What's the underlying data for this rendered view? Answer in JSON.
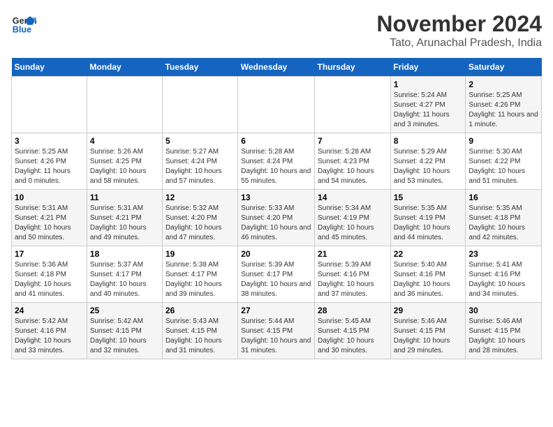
{
  "logo": {
    "line1": "General",
    "line2": "Blue"
  },
  "title": "November 2024",
  "subtitle": "Tato, Arunachal Pradesh, India",
  "days_of_week": [
    "Sunday",
    "Monday",
    "Tuesday",
    "Wednesday",
    "Thursday",
    "Friday",
    "Saturday"
  ],
  "weeks": [
    [
      {
        "num": "",
        "info": ""
      },
      {
        "num": "",
        "info": ""
      },
      {
        "num": "",
        "info": ""
      },
      {
        "num": "",
        "info": ""
      },
      {
        "num": "",
        "info": ""
      },
      {
        "num": "1",
        "info": "Sunrise: 5:24 AM\nSunset: 4:27 PM\nDaylight: 11 hours\nand 3 minutes."
      },
      {
        "num": "2",
        "info": "Sunrise: 5:25 AM\nSunset: 4:26 PM\nDaylight: 11 hours\nand 1 minute."
      }
    ],
    [
      {
        "num": "3",
        "info": "Sunrise: 5:25 AM\nSunset: 4:26 PM\nDaylight: 11 hours\nand 0 minutes."
      },
      {
        "num": "4",
        "info": "Sunrise: 5:26 AM\nSunset: 4:25 PM\nDaylight: 10 hours\nand 58 minutes."
      },
      {
        "num": "5",
        "info": "Sunrise: 5:27 AM\nSunset: 4:24 PM\nDaylight: 10 hours\nand 57 minutes."
      },
      {
        "num": "6",
        "info": "Sunrise: 5:28 AM\nSunset: 4:24 PM\nDaylight: 10 hours\nand 55 minutes."
      },
      {
        "num": "7",
        "info": "Sunrise: 5:28 AM\nSunset: 4:23 PM\nDaylight: 10 hours\nand 54 minutes."
      },
      {
        "num": "8",
        "info": "Sunrise: 5:29 AM\nSunset: 4:22 PM\nDaylight: 10 hours\nand 53 minutes."
      },
      {
        "num": "9",
        "info": "Sunrise: 5:30 AM\nSunset: 4:22 PM\nDaylight: 10 hours\nand 51 minutes."
      }
    ],
    [
      {
        "num": "10",
        "info": "Sunrise: 5:31 AM\nSunset: 4:21 PM\nDaylight: 10 hours\nand 50 minutes."
      },
      {
        "num": "11",
        "info": "Sunrise: 5:31 AM\nSunset: 4:21 PM\nDaylight: 10 hours\nand 49 minutes."
      },
      {
        "num": "12",
        "info": "Sunrise: 5:32 AM\nSunset: 4:20 PM\nDaylight: 10 hours\nand 47 minutes."
      },
      {
        "num": "13",
        "info": "Sunrise: 5:33 AM\nSunset: 4:20 PM\nDaylight: 10 hours\nand 46 minutes."
      },
      {
        "num": "14",
        "info": "Sunrise: 5:34 AM\nSunset: 4:19 PM\nDaylight: 10 hours\nand 45 minutes."
      },
      {
        "num": "15",
        "info": "Sunrise: 5:35 AM\nSunset: 4:19 PM\nDaylight: 10 hours\nand 44 minutes."
      },
      {
        "num": "16",
        "info": "Sunrise: 5:35 AM\nSunset: 4:18 PM\nDaylight: 10 hours\nand 42 minutes."
      }
    ],
    [
      {
        "num": "17",
        "info": "Sunrise: 5:36 AM\nSunset: 4:18 PM\nDaylight: 10 hours\nand 41 minutes."
      },
      {
        "num": "18",
        "info": "Sunrise: 5:37 AM\nSunset: 4:17 PM\nDaylight: 10 hours\nand 40 minutes."
      },
      {
        "num": "19",
        "info": "Sunrise: 5:38 AM\nSunset: 4:17 PM\nDaylight: 10 hours\nand 39 minutes."
      },
      {
        "num": "20",
        "info": "Sunrise: 5:39 AM\nSunset: 4:17 PM\nDaylight: 10 hours\nand 38 minutes."
      },
      {
        "num": "21",
        "info": "Sunrise: 5:39 AM\nSunset: 4:16 PM\nDaylight: 10 hours\nand 37 minutes."
      },
      {
        "num": "22",
        "info": "Sunrise: 5:40 AM\nSunset: 4:16 PM\nDaylight: 10 hours\nand 36 minutes."
      },
      {
        "num": "23",
        "info": "Sunrise: 5:41 AM\nSunset: 4:16 PM\nDaylight: 10 hours\nand 34 minutes."
      }
    ],
    [
      {
        "num": "24",
        "info": "Sunrise: 5:42 AM\nSunset: 4:16 PM\nDaylight: 10 hours\nand 33 minutes."
      },
      {
        "num": "25",
        "info": "Sunrise: 5:42 AM\nSunset: 4:15 PM\nDaylight: 10 hours\nand 32 minutes."
      },
      {
        "num": "26",
        "info": "Sunrise: 5:43 AM\nSunset: 4:15 PM\nDaylight: 10 hours\nand 31 minutes."
      },
      {
        "num": "27",
        "info": "Sunrise: 5:44 AM\nSunset: 4:15 PM\nDaylight: 10 hours\nand 31 minutes."
      },
      {
        "num": "28",
        "info": "Sunrise: 5:45 AM\nSunset: 4:15 PM\nDaylight: 10 hours\nand 30 minutes."
      },
      {
        "num": "29",
        "info": "Sunrise: 5:46 AM\nSunset: 4:15 PM\nDaylight: 10 hours\nand 29 minutes."
      },
      {
        "num": "30",
        "info": "Sunrise: 5:46 AM\nSunset: 4:15 PM\nDaylight: 10 hours\nand 28 minutes."
      }
    ]
  ]
}
